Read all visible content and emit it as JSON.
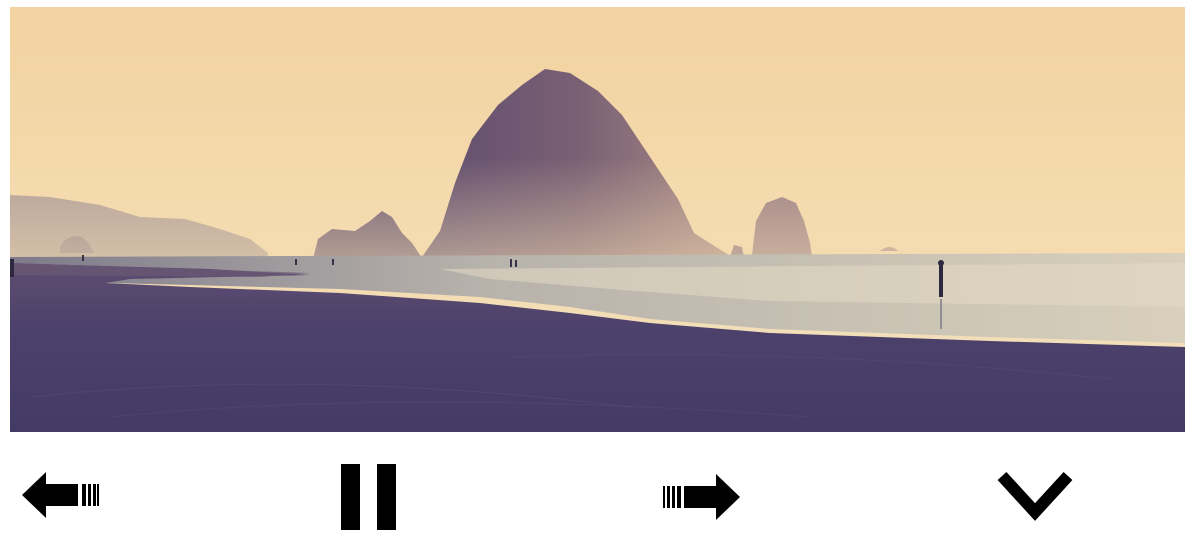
{
  "slideshow": {
    "current_slide": {
      "image_subject": "beach-with-sea-stack-at-sunset"
    },
    "controls": {
      "prev_icon": "arrow-left-icon",
      "pause_icon": "pause-icon",
      "next_icon": "arrow-right-icon",
      "more_icon": "chevron-down-icon"
    }
  },
  "colors": {
    "icon": "#000000",
    "sky_top": "#f2d6a6",
    "sky_bottom": "#f7dfb3",
    "sand": "#4b3f6a",
    "water": "#b9b6ae",
    "rock": "#6d5470"
  }
}
